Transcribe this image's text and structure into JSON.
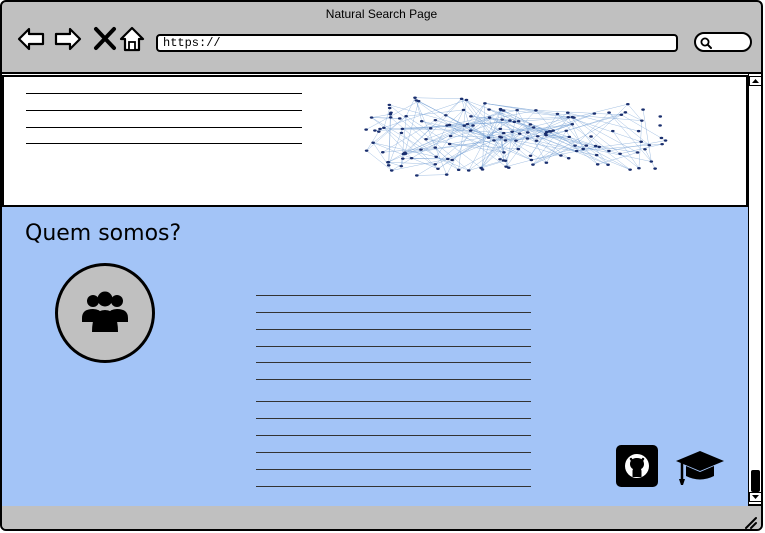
{
  "window": {
    "title": "Natural Search Page"
  },
  "toolbar": {
    "url_value": "https://",
    "icons": [
      "back-icon",
      "forward-icon",
      "close-icon",
      "home-icon",
      "search-icon"
    ]
  },
  "about": {
    "title": "Quem somos?"
  },
  "footer_icons": [
    "github-icon",
    "graduation-cap-icon"
  ],
  "colors": {
    "chrome": "#c0c0c0",
    "about_bg": "#a3c4f7",
    "network_blue": "#7aa4d6",
    "node": "#1a2f6e"
  }
}
